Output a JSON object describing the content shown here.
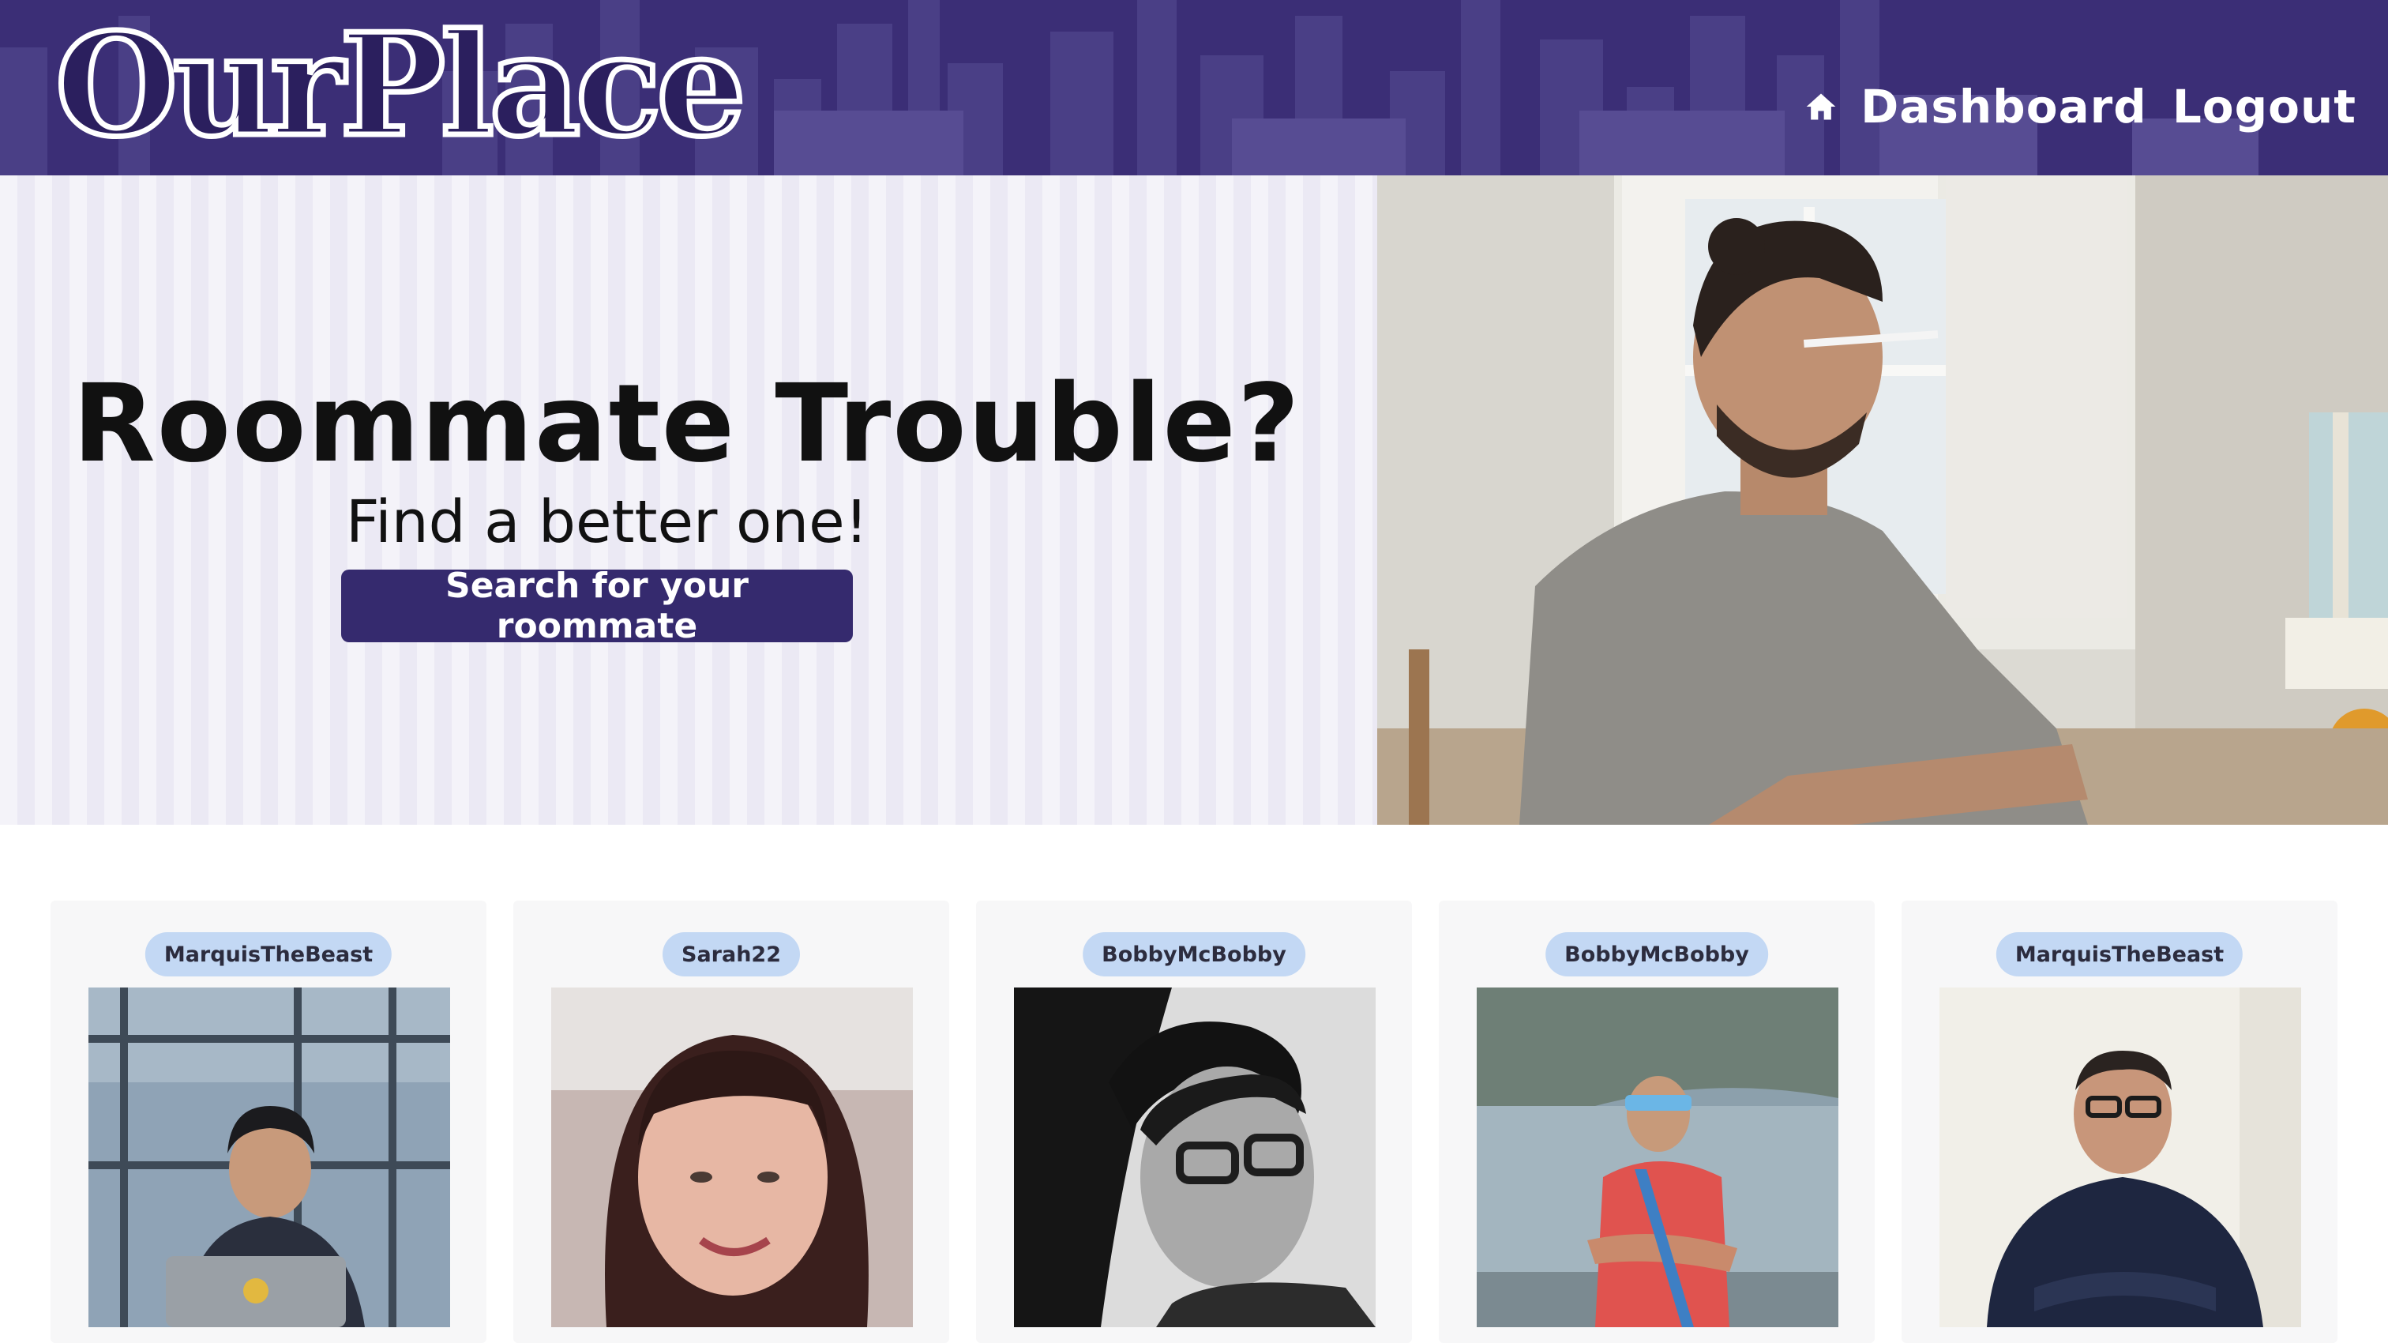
{
  "app": {
    "logo_text": "OurPlace",
    "brand_color": "#3b2e76",
    "accent_button_color": "#352a6e",
    "badge_color": "#c3d8f4"
  },
  "nav": {
    "home_icon": "home-icon",
    "dashboard_label": "Dashboard",
    "logout_label": "Logout"
  },
  "hero": {
    "title": "Roommate Trouble?",
    "subtitle": "Find a better one!",
    "cta_label": "Search for your roommate",
    "photo": "man-with-pencil-mustache-photo"
  },
  "roommates": [
    {
      "username": "MarquisTheBeast",
      "photo": "man-with-headphones-laptop-photo"
    },
    {
      "username": "Sarah22",
      "photo": "woman-with-bangs-photo"
    },
    {
      "username": "BobbyMcBobby",
      "photo": "man-with-glasses-bw-photo"
    },
    {
      "username": "BobbyMcBobby",
      "photo": "man-red-shirt-lake-photo"
    },
    {
      "username": "MarquisTheBeast",
      "photo": "man-glasses-dark-shirt-photo"
    }
  ]
}
